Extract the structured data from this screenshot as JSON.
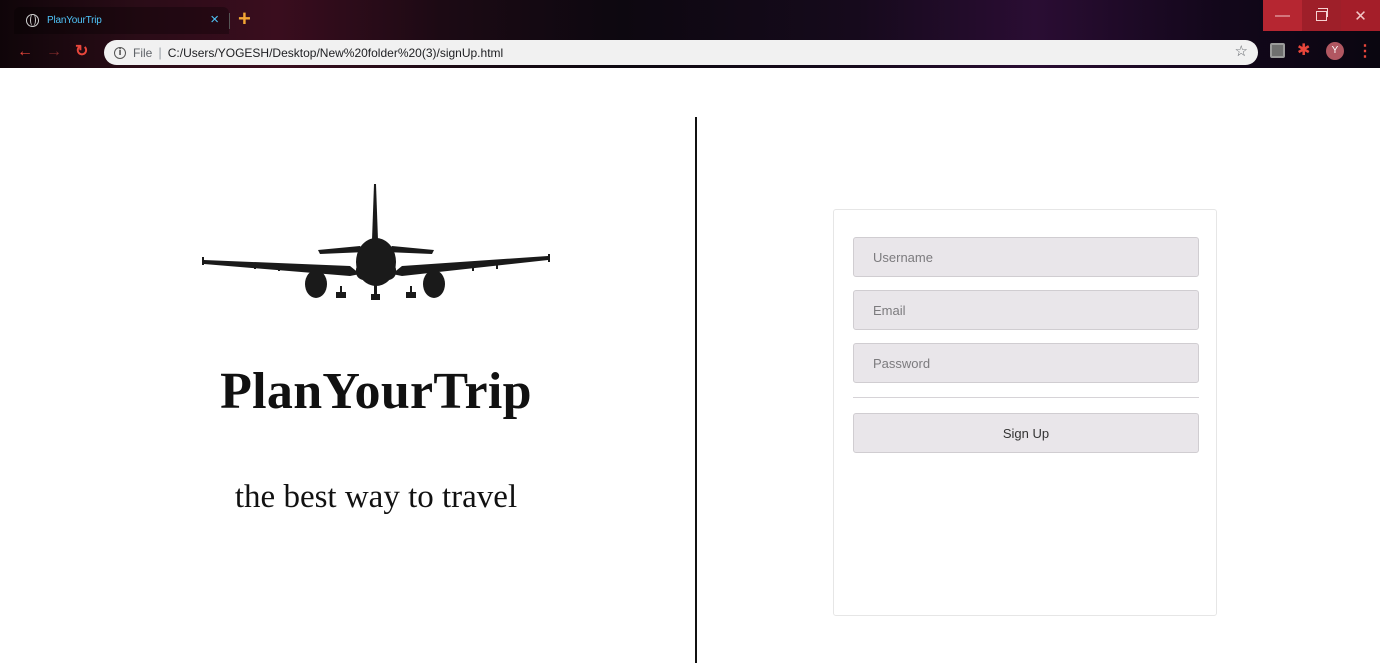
{
  "browser": {
    "tab_title": "PlanYourTrip",
    "tab_close": "×",
    "new_tab": "+",
    "omnibox_prefix": "File",
    "url": "C:/Users/YOGESH/Desktop/New%20folder%20(3)/signUp.html",
    "profile_initial": "Y",
    "icons": [
      "globe-icon",
      "close-icon",
      "plus-icon",
      "back-arrow-icon",
      "forward-arrow-icon",
      "reload-icon",
      "info-icon",
      "star-icon",
      "extension-icon",
      "puzzle-icon",
      "kebab-menu-icon",
      "minimize-icon",
      "maximize-icon",
      "window-close-icon"
    ],
    "accent_color": "#e8463b"
  },
  "hero": {
    "icon": "airplane-icon",
    "title": "PlanYourTrip",
    "tagline": "the best way to travel"
  },
  "signup_form": {
    "username_placeholder": "Username",
    "email_placeholder": "Email",
    "password_placeholder": "Password",
    "submit_label": "Sign Up",
    "field_background": "#e9e6ea"
  }
}
